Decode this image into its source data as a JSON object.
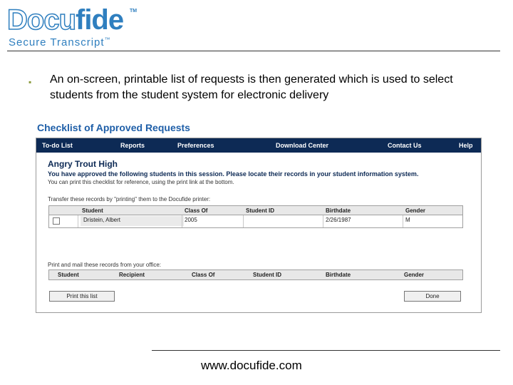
{
  "logo": {
    "part1": "Docu",
    "part2": "fide",
    "tm": "TM",
    "subtitle": "Secure Transcript",
    "subtitle_tm": "™"
  },
  "bullet": {
    "glyph": "▪",
    "text": "An on-screen, printable list of requests is then generated which is used to select students from the student system for electronic delivery"
  },
  "checklist_title": "Checklist of Approved Requests",
  "nav": {
    "items": [
      "To-do List",
      "Reports",
      "Preferences",
      "Download Center",
      "Contact Us",
      "Help"
    ]
  },
  "app": {
    "school": "Angry Trout High",
    "approved_text": "You have approved the following students in this session. Please locate their records in your student information system.",
    "approved_sub": "You can print this checklist for reference, using the print link at the bottom.",
    "transfer_text": "Transfer these records by \"printing\" them to the Docufide printer:",
    "table1": {
      "headers": [
        "Student",
        "Class Of",
        "Student ID",
        "Birthdate",
        "Gender"
      ],
      "rows": [
        {
          "student": "Dristein, Albert",
          "class_of": "2005",
          "student_id": "",
          "birthdate": "2/26/1987",
          "gender": "M"
        }
      ]
    },
    "print_mail_text": "Print and mail these records from your office:",
    "table2": {
      "headers": [
        "Student",
        "Recipient",
        "Class Of",
        "Student ID",
        "Birthdate",
        "Gender"
      ]
    },
    "print_button": "Print this list",
    "done_button": "Done"
  },
  "colors": {
    "brand": "#2f7fbf",
    "nav_bg": "#0d2a55",
    "title": "#1f5fa8",
    "bullet": "#8a9a3c"
  },
  "footer": "www.docufide.com"
}
